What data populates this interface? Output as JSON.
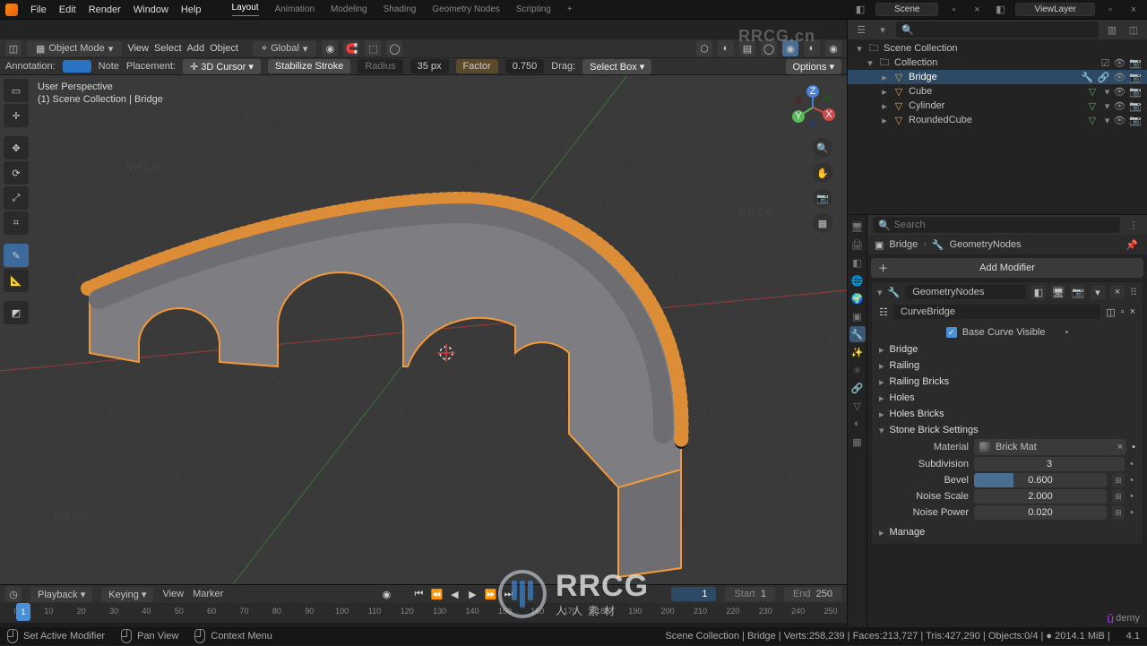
{
  "menubar": {
    "items": [
      "File",
      "Edit",
      "Render",
      "Window",
      "Help"
    ],
    "scene_label": "Scene",
    "viewlayer_label": "ViewLayer"
  },
  "workspaces": {
    "tabs": [
      "Layout",
      "Animation",
      "Modeling",
      "Shading",
      "Geometry Nodes",
      "Scripting"
    ],
    "active": "Layout"
  },
  "vp_header": {
    "mode": "Object Mode",
    "menus": [
      "View",
      "Select",
      "Add",
      "Object"
    ],
    "orientation": "Global",
    "options_label": "Options"
  },
  "vp_header2": {
    "annotation_label": "Annotation:",
    "note_label": "Note",
    "placement_label": "Placement:",
    "placement_value": "3D Cursor",
    "stabilize_label": "Stabilize Stroke",
    "radius_label": "Radius",
    "radius_value": "35 px",
    "factor_label": "Factor",
    "factor_value": "0.750",
    "drag_label": "Drag:",
    "drag_value": "Select Box"
  },
  "viewport": {
    "perspective": "User Perspective",
    "context": "(1) Scene Collection | Bridge"
  },
  "outliner": {
    "search_placeholder": "",
    "scene_collection": "Scene Collection",
    "collection": "Collection",
    "items": [
      {
        "name": "Bridge",
        "active": true
      },
      {
        "name": "Cube",
        "active": false
      },
      {
        "name": "Cylinder",
        "active": false
      },
      {
        "name": "RoundedCube",
        "active": false
      }
    ]
  },
  "properties": {
    "search_placeholder": "Search",
    "breadcrumb_obj": "Bridge",
    "breadcrumb_mod": "GeometryNodes",
    "add_modifier": "Add Modifier",
    "modifier_name": "GeometryNodes",
    "nodegroup_name": "CurveBridge",
    "base_curve_visible": "Base Curve Visible",
    "sections": [
      "Bridge",
      "Railing",
      "Railing Bricks",
      "Holes",
      "Holes Bricks"
    ],
    "open_section": "Stone Brick Settings",
    "material_label": "Material",
    "material_value": "Brick Mat",
    "params": {
      "subdivision_label": "Subdivision",
      "subdivision_value": "3",
      "bevel_label": "Bevel",
      "bevel_value": "0.600",
      "noise_scale_label": "Noise Scale",
      "noise_scale_value": "2.000",
      "noise_power_label": "Noise Power",
      "noise_power_value": "0.020"
    },
    "manage": "Manage"
  },
  "timeline": {
    "menus": [
      "Playback",
      "Keying",
      "View",
      "Marker"
    ],
    "frame": "1",
    "start_label": "Start",
    "start_value": "1",
    "end_label": "End",
    "end_value": "250",
    "ticks": [
      "0",
      "10",
      "20",
      "30",
      "40",
      "50",
      "60",
      "70",
      "80",
      "90",
      "100",
      "110",
      "120",
      "130",
      "140",
      "150",
      "160",
      "170",
      "180",
      "190",
      "200",
      "210",
      "220",
      "230",
      "240",
      "250"
    ]
  },
  "statusbar": {
    "left1": "Set Active Modifier",
    "left2": "Pan View",
    "left3": "Context Menu",
    "right": "Scene Collection | Bridge | Verts:258,239 | Faces:213,727 | Tris:427,290 | Objects:0/4 | ● 2014.1 MiB |"
  },
  "watermark": {
    "top": "RRCG.cn",
    "big": "RRCG",
    "sub": "人人素材"
  },
  "udemy": "ûdemy"
}
